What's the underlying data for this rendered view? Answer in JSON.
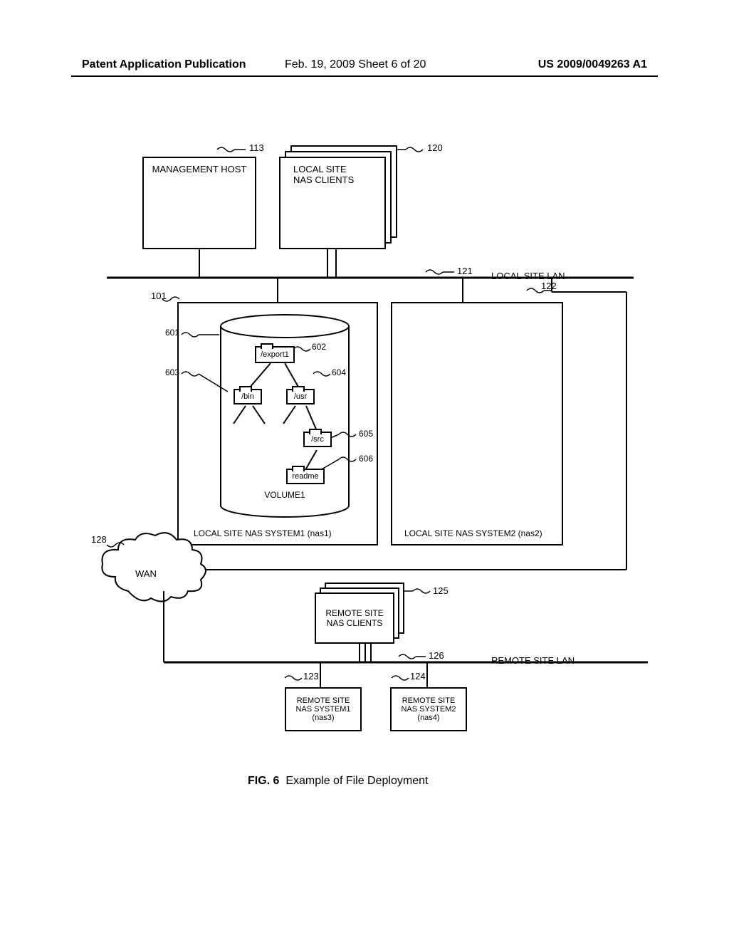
{
  "header": {
    "left": "Patent Application Publication",
    "middle": "Feb. 19, 2009   Sheet 6 of 20",
    "right": "US 2009/0049263 A1"
  },
  "figure": {
    "number": "FIG. 6",
    "caption": "Example of File Deployment"
  },
  "labels": {
    "mgmt_host": "MANAGEMENT HOST",
    "local_clients_l1": "LOCAL SITE",
    "local_clients_l2": "NAS CLIENTS",
    "local_lan": "LOCAL SITE LAN",
    "local_nas1": "LOCAL SITE NAS SYSTEM1 (nas1)",
    "local_nas2": "LOCAL SITE NAS SYSTEM2 (nas2)",
    "volume1": "VOLUME1",
    "wan": "WAN",
    "remote_clients_l1": "REMOTE SITE",
    "remote_clients_l2": "NAS CLIENTS",
    "remote_lan": "REMOTE SITE LAN",
    "remote_nas3_l1": "REMOTE SITE",
    "remote_nas3_l2": "NAS SYSTEM1",
    "remote_nas3_l3": "(nas3)",
    "remote_nas4_l1": "REMOTE SITE",
    "remote_nas4_l2": "NAS SYSTEM2",
    "remote_nas4_l3": "(nas4)"
  },
  "fs": {
    "export1": "/export1",
    "bin": "/bin",
    "usr": "/usr",
    "src": "/src",
    "readme": "readme"
  },
  "refs": {
    "r113": "113",
    "r120": "120",
    "r121": "121",
    "r122": "122",
    "r101": "101",
    "r601": "601",
    "r602": "602",
    "r603": "603",
    "r604": "604",
    "r605": "605",
    "r606": "606",
    "r128": "128",
    "r125": "125",
    "r126": "126",
    "r123": "123",
    "r124": "124"
  }
}
